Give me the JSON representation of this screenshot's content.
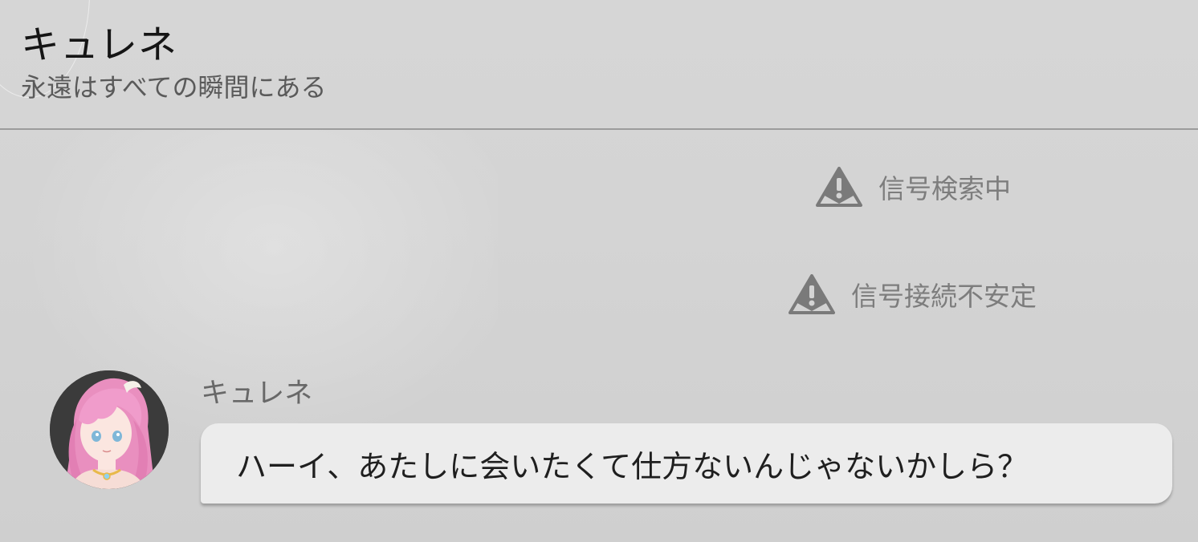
{
  "header": {
    "title": "キュレネ",
    "subtitle": "永遠はすべての瞬間にある"
  },
  "status_messages": [
    {
      "icon": "warning-triangle-icon",
      "text": "信号検索中"
    },
    {
      "icon": "warning-triangle-icon",
      "text": "信号接続不安定"
    }
  ],
  "message": {
    "sender": "キュレネ",
    "avatar_icon": "pink-haired-character-avatar",
    "text": "ハーイ、あたしに会いたくて仕方ないんじゃないかしら？"
  },
  "colors": {
    "background": "#d4d4d4",
    "bubble": "#ececec",
    "status_text": "#7d7d7d",
    "title_text": "#151515"
  }
}
